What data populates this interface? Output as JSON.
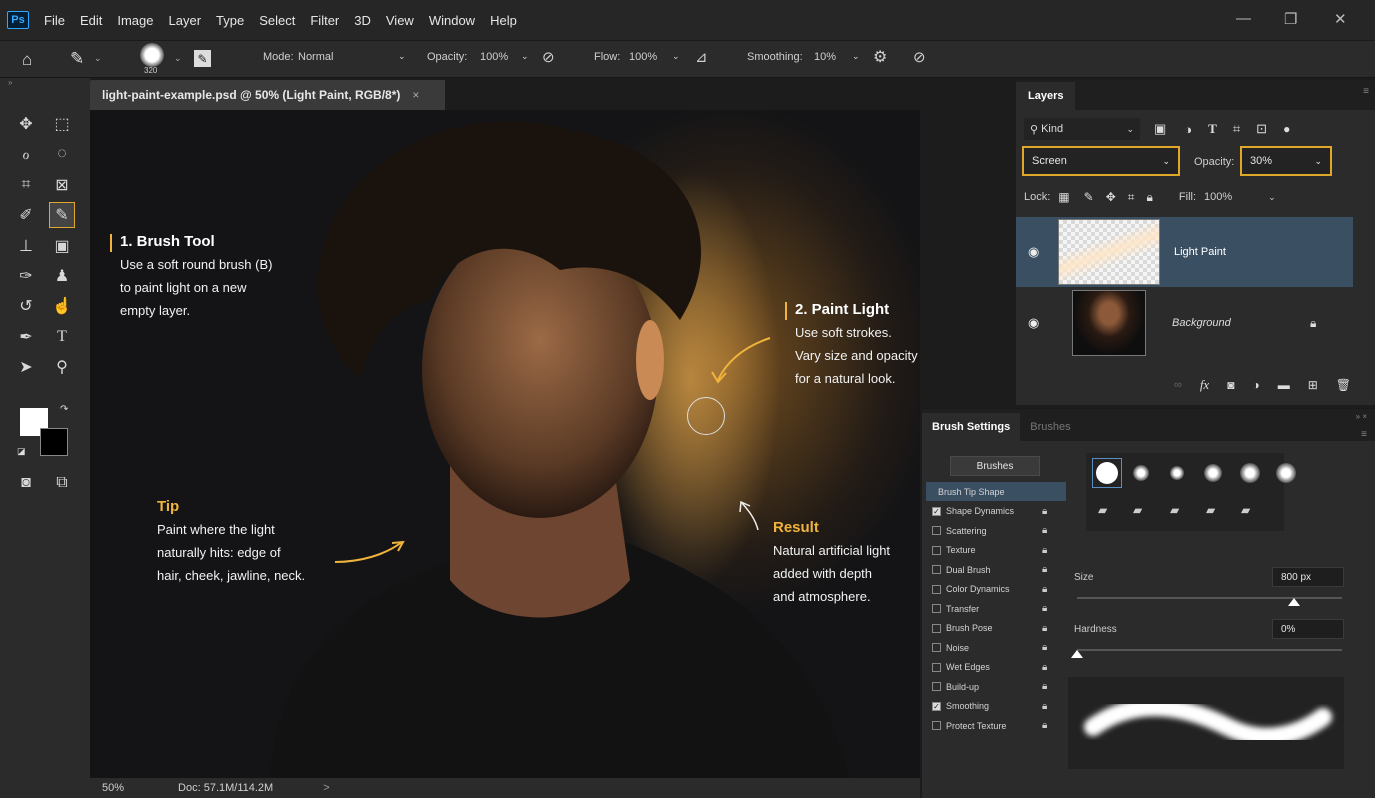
{
  "app": {
    "logo": "Ps"
  },
  "menu": [
    "File",
    "Edit",
    "Image",
    "Layer",
    "Type",
    "Select",
    "Filter",
    "3D",
    "View",
    "Window",
    "Help"
  ],
  "options": {
    "brush_size": "320",
    "mode_label": "Mode:",
    "mode_value": "Normal",
    "opacity_label": "Opacity:",
    "opacity_value": "100%",
    "flow_label": "Flow:",
    "flow_value": "100%",
    "smoothing_label": "Smoothing:",
    "smoothing_value": "10%"
  },
  "document": {
    "tab_title": "light-paint-example.psd @ 50% (Light Paint, RGB/8*)",
    "close": "×"
  },
  "annotations": {
    "brush": {
      "title": "1. Brush Tool",
      "lines": [
        "Use a soft round brush (B)",
        "to paint light on a new",
        "empty layer."
      ]
    },
    "paint": {
      "title": "2. Paint Light",
      "lines": [
        "Use soft strokes.",
        "Vary size and opacity",
        "for a natural look."
      ]
    },
    "tip": {
      "title": "Tip",
      "lines": [
        "Paint where the light",
        "naturally hits: edge of",
        "hair, cheek, jawline, neck."
      ]
    },
    "result": {
      "title": "Result",
      "lines": [
        "Natural artificial light",
        "added with depth",
        "and atmosphere."
      ]
    }
  },
  "status": {
    "zoom": "50%",
    "doc": "Doc: 57.1M/114.2M",
    "arrow": ">"
  },
  "layers_panel": {
    "tab": "Layers",
    "filter": "Kind",
    "blend_mode": "Screen",
    "opacity_label": "Opacity:",
    "opacity_value": "30%",
    "lock_label": "Lock:",
    "fill_label": "Fill:",
    "fill_value": "100%",
    "layers": [
      {
        "name": "Light Paint"
      },
      {
        "name": "Background"
      }
    ]
  },
  "brush_settings": {
    "tab_active": "Brush Settings",
    "tab_inactive": "Brushes",
    "brushes_button": "Brushes",
    "items": [
      {
        "label": "Brush Tip Shape",
        "checked": null
      },
      {
        "label": "Shape Dynamics",
        "checked": true
      },
      {
        "label": "Scattering",
        "checked": false
      },
      {
        "label": "Texture",
        "checked": false
      },
      {
        "label": "Dual Brush",
        "checked": false
      },
      {
        "label": "Color Dynamics",
        "checked": false
      },
      {
        "label": "Transfer",
        "checked": false
      },
      {
        "label": "Brush Pose",
        "checked": false
      },
      {
        "label": "Noise",
        "checked": false
      },
      {
        "label": "Wet Edges",
        "checked": false
      },
      {
        "label": "Build-up",
        "checked": false
      },
      {
        "label": "Smoothing",
        "checked": true
      },
      {
        "label": "Protect Texture",
        "checked": false
      }
    ],
    "size_label": "Size",
    "size_value": "800 px",
    "hardness_label": "Hardness",
    "hardness_value": "0%",
    "size_fraction": 0.82,
    "hardness_fraction": 0.0
  },
  "colors": {
    "accent": "#e0a82a",
    "selected_layer": "#3b4f63"
  }
}
